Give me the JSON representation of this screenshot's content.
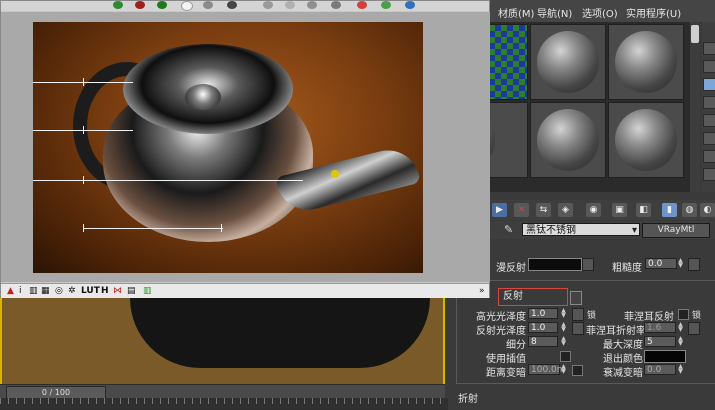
{
  "menubar": {
    "items": [
      "材质(M)",
      "导航(N)",
      "选项(O)",
      "实用程序(U)"
    ]
  },
  "colors": {
    "accent_highlight": "#d8473d",
    "viewport_border": "#d9b400"
  },
  "timeline": {
    "frame_counter": "0 / 100"
  },
  "material": {
    "name": "黑钛不锈钢",
    "type": "VRayMtl"
  },
  "diffuse": {
    "label": "漫反射",
    "roughness_label": "粗糙度",
    "roughness_value": "0.0"
  },
  "reflection": {
    "title": "反射",
    "hilight_gloss_label": "高光光泽度",
    "hilight_gloss_value": "1.0",
    "lock_label": "锁",
    "fresnel_label": "菲涅耳反射",
    "refl_gloss_label": "反射光泽度",
    "refl_gloss_value": "1.0",
    "fresnel_ior_label": "菲涅耳折射率",
    "fresnel_ior_value": "1.6",
    "subdivs_label": "细分",
    "subdivs_value": "8",
    "max_depth_label": "最大深度",
    "max_depth_value": "5",
    "use_interp_label": "使用插值",
    "exit_color_label": "退出颜色",
    "dim_distance_label": "距离变暗",
    "dim_distance_value": "100.0m",
    "dim_falloff_label": "衰减变暗",
    "dim_falloff_value": "0.0"
  },
  "refraction": {
    "title": "折射"
  },
  "render_window": {
    "bottom_tools": [
      "i",
      "LUT",
      "H"
    ]
  }
}
